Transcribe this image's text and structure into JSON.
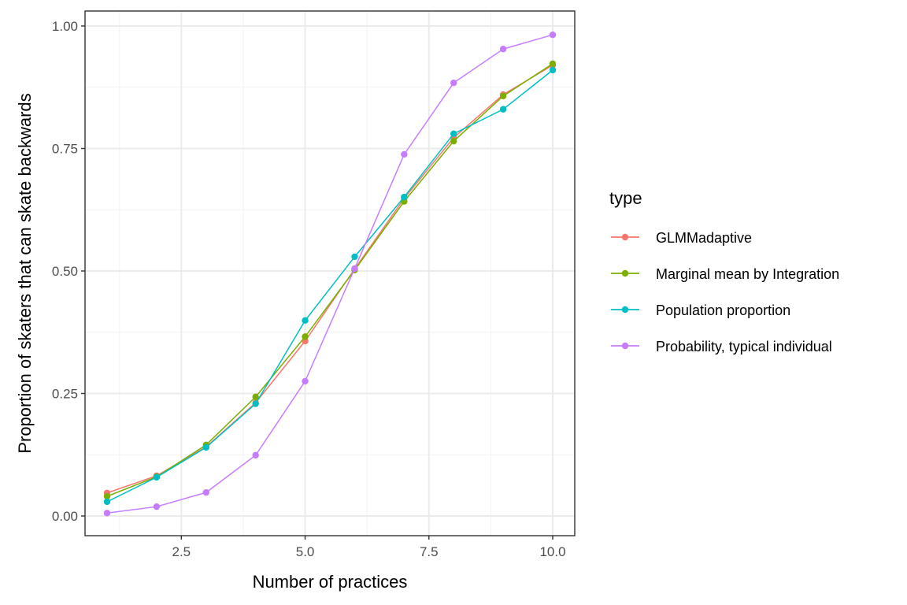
{
  "chart_data": {
    "type": "line",
    "title": "",
    "xlabel": "Number of practices",
    "ylabel": "Proportion of skaters that can skate backwards",
    "xlim": [
      0.55,
      10.45
    ],
    "ylim": [
      -0.04,
      1.03
    ],
    "xticks": [
      2.5,
      5.0,
      7.5,
      10.0
    ],
    "xtick_labels": [
      "2.5",
      "5.0",
      "7.5",
      "10.0"
    ],
    "yticks": [
      0.0,
      0.25,
      0.5,
      0.75,
      1.0
    ],
    "ytick_labels": [
      "0.00",
      "0.25",
      "0.50",
      "0.75",
      "1.00"
    ],
    "grid": true,
    "legend": {
      "title": "type",
      "placement": "right"
    },
    "x": [
      1,
      2,
      3,
      4,
      5,
      6,
      7,
      8,
      9,
      10
    ],
    "series": [
      {
        "name": "GLMMadaptive",
        "color": "#F8766D",
        "values": [
          0.047,
          0.082,
          0.141,
          0.231,
          0.357,
          0.504,
          0.648,
          0.772,
          0.86,
          0.92
        ]
      },
      {
        "name": "Marginal mean by Integration",
        "color": "#7CAE00",
        "values": [
          0.04,
          0.08,
          0.145,
          0.243,
          0.366,
          0.502,
          0.642,
          0.765,
          0.857,
          0.923
        ]
      },
      {
        "name": "Population proportion",
        "color": "#00BFC4",
        "values": [
          0.029,
          0.079,
          0.14,
          0.229,
          0.399,
          0.529,
          0.651,
          0.78,
          0.83,
          0.91
        ]
      },
      {
        "name": "Probability, typical individual",
        "color": "#C77CFF",
        "values": [
          0.006,
          0.019,
          0.048,
          0.124,
          0.275,
          0.505,
          0.738,
          0.884,
          0.953,
          0.982
        ]
      }
    ]
  }
}
